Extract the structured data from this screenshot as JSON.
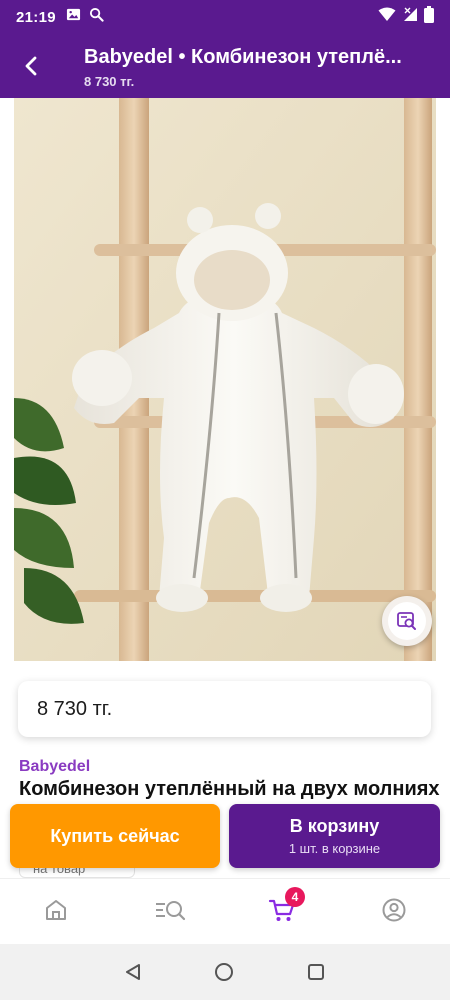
{
  "status_bar": {
    "time": "21:19",
    "left_icons": [
      "image-icon",
      "search-icon"
    ],
    "right_icons": [
      "wifi-icon",
      "signal-icon",
      "battery-icon"
    ]
  },
  "app_bar": {
    "title": "Babyedel • Комбинезон утеплё...",
    "subtitle": "8 730 тг."
  },
  "product": {
    "price": "8 730 тг.",
    "brand": "Babyedel",
    "title": "Комбинезон утеплённый на двух молниях",
    "review_hint": "на товар"
  },
  "actions": {
    "buy_now": "Купить сейчас",
    "add_to_cart": "В корзину",
    "cart_status": "1 шт. в корзине"
  },
  "bottom_nav": {
    "items": [
      "home-icon",
      "catalog-search-icon",
      "cart-icon",
      "profile-icon"
    ],
    "cart_badge": "4",
    "active_color": "#8a2be2"
  },
  "colors": {
    "primary": "#5a1a8f",
    "accent_orange": "#ff9800",
    "brand_text": "#8a3bc1",
    "badge": "#e8185d"
  }
}
